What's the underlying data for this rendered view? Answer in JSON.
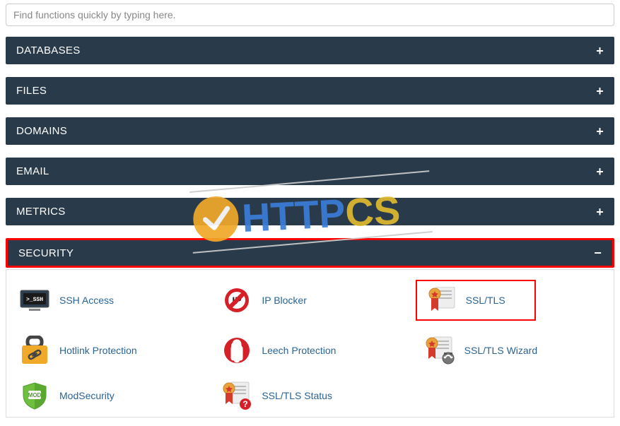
{
  "search": {
    "placeholder": "Find functions quickly by typing here."
  },
  "panels": {
    "databases": {
      "title": "DATABASES"
    },
    "files": {
      "title": "FILES"
    },
    "domains": {
      "title": "DOMAINS"
    },
    "email": {
      "title": "EMAIL"
    },
    "metrics": {
      "title": "METRICS"
    },
    "security": {
      "title": "SECURITY"
    }
  },
  "security_items": {
    "ssh": {
      "label": "SSH Access"
    },
    "ipblocker": {
      "label": "IP Blocker"
    },
    "ssltls": {
      "label": "SSL/TLS"
    },
    "hotlink": {
      "label": "Hotlink Protection"
    },
    "leech": {
      "label": "Leech Protection"
    },
    "sslwizard": {
      "label": "SSL/TLS Wizard"
    },
    "modsec": {
      "label": "ModSecurity"
    },
    "sslstatus": {
      "label": "SSL/TLS Status"
    }
  },
  "watermark": {
    "text1": "HTTP",
    "text2": "CS"
  }
}
